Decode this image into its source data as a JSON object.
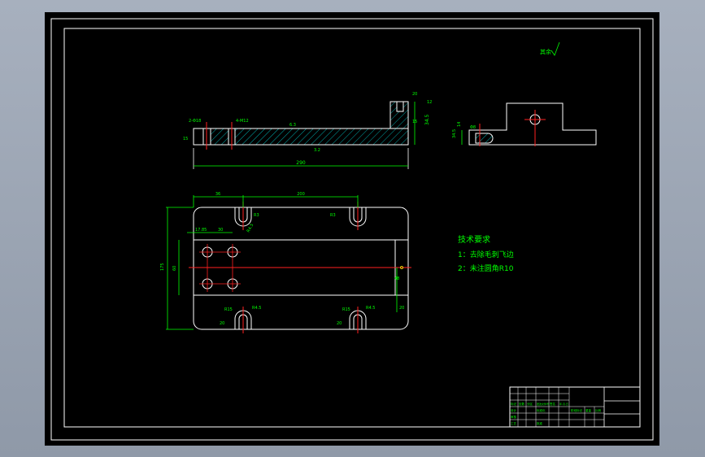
{
  "title_block": {
    "rows": [
      [
        "标记",
        "处数",
        "分区",
        "更改文件号",
        "签名",
        "年.月.日"
      ],
      [
        "设计",
        "",
        "",
        "标准化",
        "",
        ""
      ],
      [
        "审核",
        "",
        "",
        "",
        "",
        ""
      ],
      [
        "工艺",
        "",
        "",
        "批准",
        "",
        ""
      ]
    ],
    "stage_label": "阶段标记",
    "weight_label": "重量",
    "scale_label": "比例"
  },
  "technical_requirements": {
    "title": "技术要求",
    "items": [
      "1：去除毛刺飞边",
      "2：未注圆角R10"
    ]
  },
  "roughness_note": "其余",
  "front_view": {
    "dims": {
      "left_hole": "2-Φ18",
      "tap": "4-M12",
      "slot_height": "15",
      "slot_depth": "20",
      "slot_top": "12",
      "right_height": "34.5",
      "hatch_rough": "6.3",
      "left_height": "15",
      "bottom_rough": "3.2",
      "overall_length": "290"
    }
  },
  "side_view": {
    "dims": {
      "top": "Φ8",
      "left1": "14",
      "left2": "34.5"
    }
  },
  "plan_view": {
    "dims": {
      "top_left": "36",
      "top_span": "200",
      "overall_height": "175",
      "inner_height": "60",
      "hole_offset": "17.85",
      "hole_pitch": "30",
      "slot_r1": "R3",
      "slot_r2": "R4.5",
      "right_offset": "48",
      "bottom_offset": "20",
      "slot_b1": "R15",
      "slot_b2": "R4.5",
      "width_b1": "20",
      "width_b2": "20"
    }
  }
}
